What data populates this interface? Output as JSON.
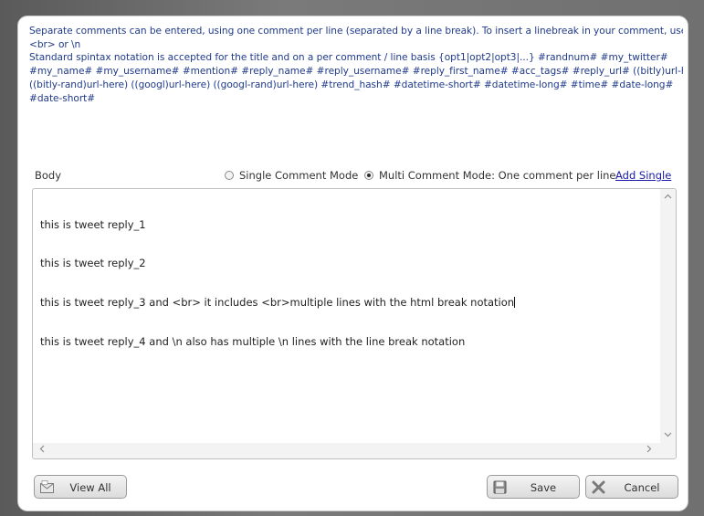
{
  "instructions": {
    "lines": [
      "Separate comments can be entered, using one comment per line (separated by a line break). To insert a linebreak in your comment, use",
      "<br> or \\n",
      "Standard spintax notation is accepted for the title and on a per comment / line basis {opt1|opt2|opt3|...} #randnum# #my_twitter#",
      "#my_name# #my_username# #mention# #reply_name# #reply_username# #reply_first_name# #acc_tags# #reply_url# ((bitly)url-here)",
      "((bitly-rand)url-here) ((googl)url-here) ((googl-rand)url-here) #trend_hash# #datetime-short# #datetime-long# #time# #date-long#",
      "#date-short#"
    ]
  },
  "body": {
    "label": "Body",
    "mode_single_label": "Single Comment Mode",
    "mode_multi_label": "Multi Comment Mode: One comment per line",
    "selected_mode": "multi",
    "add_single_label": "Add Single",
    "lines": [
      "this is tweet reply_1",
      "this is tweet reply_2",
      "this is tweet reply_3 and <br> it includes <br>multiple lines with the html break notation",
      "this is tweet reply_4 and \\n also has multiple \\n lines with the line break notation"
    ]
  },
  "buttons": {
    "view_all": "View All",
    "save": "Save",
    "cancel": "Cancel"
  },
  "icons": {
    "view_all": "envelope-icon",
    "save": "floppy-disk-icon",
    "cancel": "x-mark-icon"
  },
  "colors": {
    "instruction_text": "#1f3a8a",
    "link": "#1a1aa6"
  }
}
